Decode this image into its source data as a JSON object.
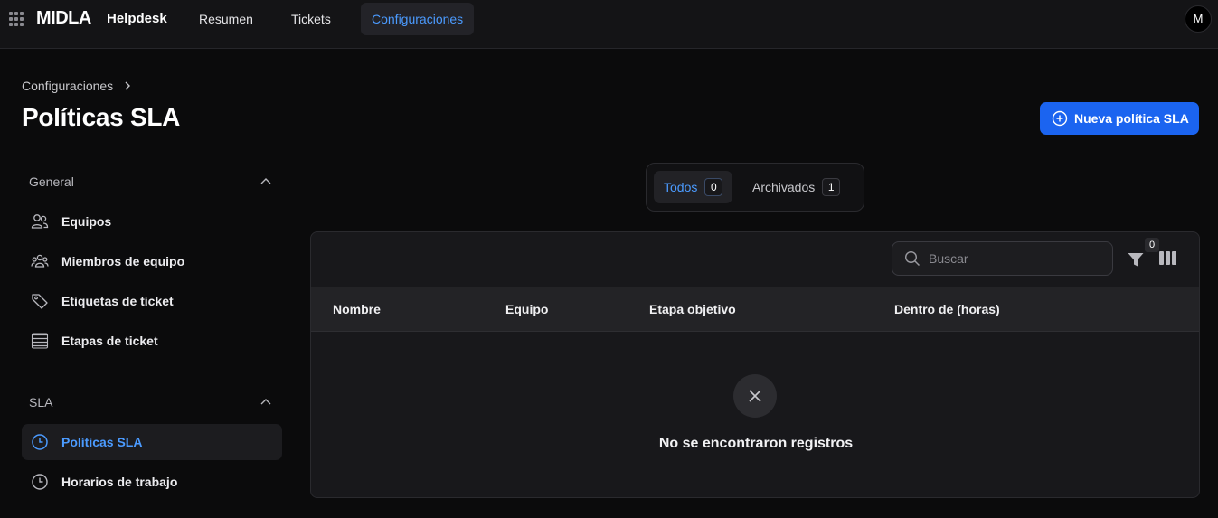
{
  "topbar": {
    "logo": "MIDLA",
    "app_name": "Helpdesk",
    "tabs": [
      {
        "label": "Resumen"
      },
      {
        "label": "Tickets"
      },
      {
        "label": "Configuraciones",
        "active": true
      }
    ],
    "avatar_initial": "M",
    "apps_icon": "grid-icon"
  },
  "header": {
    "breadcrumb": "Configuraciones",
    "title": "Políticas SLA",
    "new_button_label": "Nueva política SLA"
  },
  "sidebar": {
    "sections": [
      {
        "title": "General",
        "items": [
          {
            "label": "Equipos",
            "icon": "users-icon"
          },
          {
            "label": "Miembros de equipo",
            "icon": "team-members-icon"
          },
          {
            "label": "Etiquetas de ticket",
            "icon": "tag-icon"
          },
          {
            "label": "Etapas de ticket",
            "icon": "stages-icon"
          }
        ]
      },
      {
        "title": "SLA",
        "items": [
          {
            "label": "Políticas SLA",
            "icon": "clock-icon",
            "active": true
          },
          {
            "label": "Horarios de trabajo",
            "icon": "clock-icon"
          }
        ]
      }
    ]
  },
  "filters": {
    "tabs": [
      {
        "label": "Todos",
        "count": "0",
        "active": true
      },
      {
        "label": "Archivados",
        "count": "1"
      }
    ]
  },
  "table": {
    "search_placeholder": "Buscar",
    "filter_count": "0",
    "columns": [
      "Nombre",
      "Equipo",
      "Etapa objetivo",
      "Dentro de (horas)"
    ],
    "rows": [],
    "empty_message": "No se encontraron registros"
  },
  "colors": {
    "accent": "#4b9bff",
    "primary_button": "#1b64f0",
    "background": "#0b0b0c"
  }
}
